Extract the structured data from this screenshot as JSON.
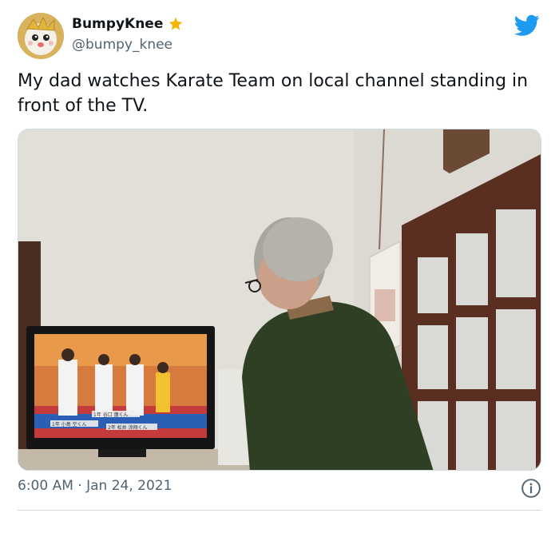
{
  "author": {
    "display_name": "BumpyKnee",
    "handle": "@bumpy_knee",
    "avatar_icon": "cartoon-character-avatar",
    "verified_icon": "star-icon"
  },
  "tweet": {
    "text": "My dad watches Karate Team on local channel standing in front of the TV.",
    "media_description_icon": "photo"
  },
  "tv_screen": {
    "caption_1": "1年 谷口 蓮くん",
    "caption_2": "1年 小島 空くん",
    "caption_3": "2年 松井 涼翔くん"
  },
  "footer": {
    "time": "6:00 AM",
    "separator": "·",
    "date": "Jan 24, 2021"
  },
  "colors": {
    "brand": "#1d9bf0",
    "star": "#f4b400",
    "secondary_text": "#536471",
    "border": "#cfd9de"
  }
}
